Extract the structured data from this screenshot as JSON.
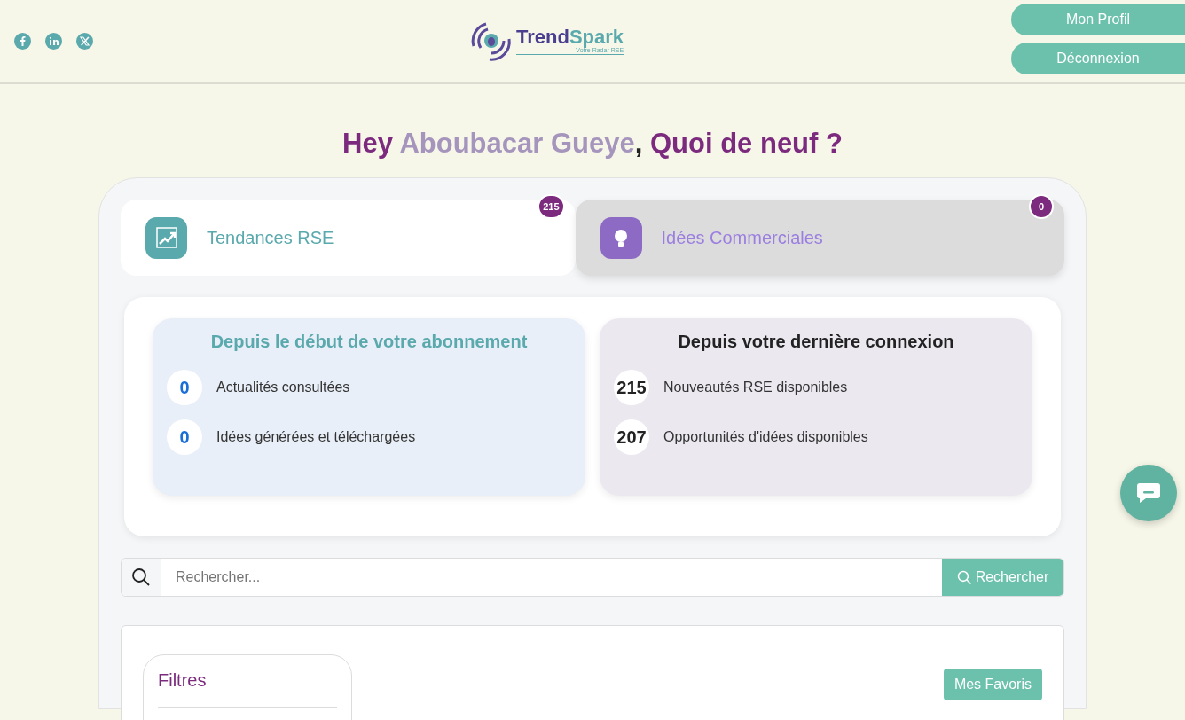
{
  "header": {
    "logo": {
      "name_first": "Trend",
      "name_second": "Spark",
      "tagline": "Votre Radar RSE"
    },
    "buttons": [
      "Mon Profil",
      "Déconnexion"
    ]
  },
  "greeting": {
    "hello": "Hey",
    "user": "Aboubacar Gueye",
    "rest": ", Quoi de neuf ?"
  },
  "tabs": [
    {
      "label": "Tendances RSE",
      "count": "215",
      "kind": "trend",
      "selected": true
    },
    {
      "label": "Idées Commerciales",
      "count": "0",
      "kind": "idea",
      "selected": false
    }
  ],
  "stats": [
    {
      "title": "Depuis le début de votre abonnement",
      "kind": "subscription",
      "items": [
        {
          "value": "0",
          "label": "Actualités consultées"
        },
        {
          "value": "0",
          "label": "Idées générées et téléchargées"
        }
      ]
    },
    {
      "title": "Depuis votre dernière connexion",
      "kind": "last_login",
      "items": [
        {
          "value": "215",
          "label": "Nouveautés RSE disponibles"
        },
        {
          "value": "207",
          "label": "Opportunités d'idées disponibles"
        }
      ]
    }
  ],
  "search": {
    "placeholder": "Rechercher...",
    "button": "Rechercher"
  },
  "filters": {
    "title": "Filtres"
  },
  "favorites_button": "Mes Favoris"
}
